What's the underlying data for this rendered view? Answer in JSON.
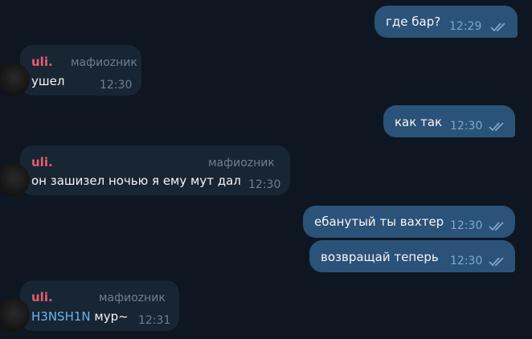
{
  "messages": [
    {
      "id": 1,
      "dir": "out",
      "text": "где бар?",
      "time": "12:29"
    },
    {
      "id": 2,
      "dir": "in",
      "sender": "uli.",
      "role": "мафиоzник",
      "text": "ушел",
      "time": "12:30"
    },
    {
      "id": 3,
      "dir": "out",
      "text": "как так",
      "time": "12:30"
    },
    {
      "id": 4,
      "dir": "in",
      "sender": "uli.",
      "role": "мафиоzник",
      "text": "он зашизел ночью я ему мут дал",
      "time": "12:30"
    },
    {
      "id": 5,
      "dir": "out",
      "text": "ебанутый ты вахтер",
      "time": "12:30"
    },
    {
      "id": 6,
      "dir": "out",
      "text": "возвращай теперь",
      "time": "12:30"
    },
    {
      "id": 7,
      "dir": "in",
      "sender": "uli.",
      "role": "мафиоzник",
      "mention": "H3NSH1N",
      "text": " мур~",
      "time": "12:31"
    }
  ],
  "colors": {
    "background": "#0e1621",
    "outgoing_bubble": "#2b5278",
    "incoming_bubble": "#182533",
    "sender_name": "#e85d70",
    "mention": "#6ab3f3",
    "read_check": "#7ea8d0"
  },
  "icons": {
    "read": "double-check-icon"
  }
}
